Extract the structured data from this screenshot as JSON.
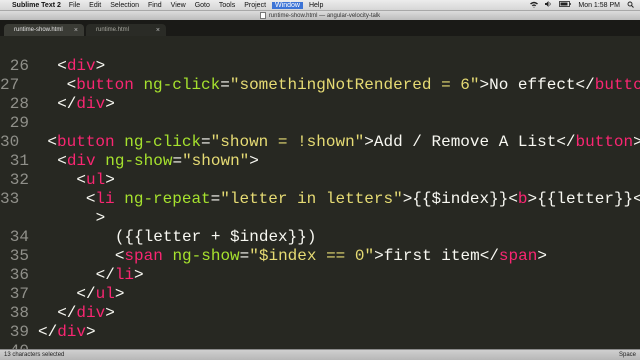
{
  "menubar": {
    "app_name": "Sublime Text 2",
    "items": [
      "File",
      "Edit",
      "Selection",
      "Find",
      "View",
      "Goto",
      "Tools",
      "Project",
      "Window",
      "Help"
    ],
    "active_item": "Window",
    "clock": "Mon 1:58 PM"
  },
  "window": {
    "title": "runtime-show.html — angular-velocity-talk"
  },
  "tabs": [
    {
      "label": "runtime-show.html",
      "active": true
    },
    {
      "label": "runtime.html",
      "active": false
    }
  ],
  "code_lines": [
    {
      "num": "",
      "tokens": []
    },
    {
      "num": "26",
      "tokens": [
        {
          "t": "  ",
          "c": "txt"
        },
        {
          "t": "<",
          "c": "txt"
        },
        {
          "t": "div",
          "c": "tag"
        },
        {
          "t": ">",
          "c": "txt"
        }
      ]
    },
    {
      "num": "27",
      "tokens": [
        {
          "t": "    ",
          "c": "txt"
        },
        {
          "t": "<",
          "c": "txt"
        },
        {
          "t": "button",
          "c": "tag"
        },
        {
          "t": " ",
          "c": "txt"
        },
        {
          "t": "ng-click",
          "c": "attr"
        },
        {
          "t": "=",
          "c": "txt"
        },
        {
          "t": "\"somethingNotRendered = 6\"",
          "c": "str"
        },
        {
          "t": ">No effect</",
          "c": "txt"
        },
        {
          "t": "button",
          "c": "tag"
        },
        {
          "t": ">",
          "c": "txt"
        }
      ]
    },
    {
      "num": "28",
      "tokens": [
        {
          "t": "  ",
          "c": "txt"
        },
        {
          "t": "</",
          "c": "txt"
        },
        {
          "t": "div",
          "c": "tag"
        },
        {
          "t": ">",
          "c": "txt"
        }
      ]
    },
    {
      "num": "29",
      "tokens": []
    },
    {
      "num": "30",
      "tokens": [
        {
          "t": "  ",
          "c": "txt"
        },
        {
          "t": "<",
          "c": "txt"
        },
        {
          "t": "button",
          "c": "tag"
        },
        {
          "t": " ",
          "c": "txt"
        },
        {
          "t": "ng-click",
          "c": "attr"
        },
        {
          "t": "=",
          "c": "txt"
        },
        {
          "t": "\"shown = !shown\"",
          "c": "str"
        },
        {
          "t": ">Add / Remove A List</",
          "c": "txt"
        },
        {
          "t": "button",
          "c": "tag"
        },
        {
          "t": ">",
          "c": "txt"
        }
      ]
    },
    {
      "num": "31",
      "tokens": [
        {
          "t": "  ",
          "c": "txt"
        },
        {
          "t": "<",
          "c": "txt"
        },
        {
          "t": "div",
          "c": "tag"
        },
        {
          "t": " ",
          "c": "txt"
        },
        {
          "t": "ng-show",
          "c": "attr"
        },
        {
          "t": "=",
          "c": "txt"
        },
        {
          "t": "\"shown\"",
          "c": "str"
        },
        {
          "t": ">",
          "c": "txt"
        }
      ]
    },
    {
      "num": "32",
      "tokens": [
        {
          "t": "    ",
          "c": "txt"
        },
        {
          "t": "<",
          "c": "txt"
        },
        {
          "t": "ul",
          "c": "tag"
        },
        {
          "t": ">",
          "c": "txt"
        }
      ]
    },
    {
      "num": "33",
      "tokens": [
        {
          "t": "      ",
          "c": "txt"
        },
        {
          "t": "<",
          "c": "txt"
        },
        {
          "t": "li",
          "c": "tag"
        },
        {
          "t": " ",
          "c": "txt"
        },
        {
          "t": "ng-repeat",
          "c": "attr"
        },
        {
          "t": "=",
          "c": "txt"
        },
        {
          "t": "\"letter in letters\"",
          "c": "str"
        },
        {
          "t": ">{{$index}}<",
          "c": "txt"
        },
        {
          "t": "b",
          "c": "tag"
        },
        {
          "t": ">{{letter}}</",
          "c": "txt"
        },
        {
          "t": "b",
          "c": "tag"
        },
        {
          "t": "><",
          "c": "txt"
        }
      ]
    },
    {
      "num": "",
      "tokens": [
        {
          "t": "      >",
          "c": "txt"
        }
      ]
    },
    {
      "num": "34",
      "tokens": [
        {
          "t": "        ({{letter + $index}})",
          "c": "txt"
        }
      ]
    },
    {
      "num": "35",
      "tokens": [
        {
          "t": "        ",
          "c": "txt"
        },
        {
          "t": "<",
          "c": "txt"
        },
        {
          "t": "span",
          "c": "tag"
        },
        {
          "t": " ",
          "c": "txt"
        },
        {
          "t": "ng-show",
          "c": "attr"
        },
        {
          "t": "=",
          "c": "txt"
        },
        {
          "t": "\"$index == 0\"",
          "c": "str"
        },
        {
          "t": ">first item</",
          "c": "txt"
        },
        {
          "t": "span",
          "c": "tag"
        },
        {
          "t": ">",
          "c": "txt"
        }
      ]
    },
    {
      "num": "36",
      "tokens": [
        {
          "t": "      ",
          "c": "txt"
        },
        {
          "t": "</",
          "c": "txt"
        },
        {
          "t": "li",
          "c": "tag"
        },
        {
          "t": ">",
          "c": "txt"
        }
      ]
    },
    {
      "num": "37",
      "tokens": [
        {
          "t": "    ",
          "c": "txt"
        },
        {
          "t": "</",
          "c": "txt"
        },
        {
          "t": "ul",
          "c": "tag"
        },
        {
          "t": ">",
          "c": "txt"
        }
      ]
    },
    {
      "num": "38",
      "tokens": [
        {
          "t": "  ",
          "c": "txt"
        },
        {
          "t": "</",
          "c": "txt"
        },
        {
          "t": "div",
          "c": "tag"
        },
        {
          "t": ">",
          "c": "txt"
        }
      ]
    },
    {
      "num": "39",
      "tokens": [
        {
          "t": "</",
          "c": "txt"
        },
        {
          "t": "div",
          "c": "tag"
        },
        {
          "t": ">",
          "c": "txt"
        }
      ]
    },
    {
      "num": "40",
      "tokens": []
    }
  ],
  "status": {
    "left": "13 characters selected",
    "right": "Space"
  },
  "colors": {
    "background": "#272822",
    "tag": "#f92672",
    "attribute": "#a6e22e",
    "string": "#e6db74",
    "text": "#f8f8f2",
    "line_number": "#90908a"
  },
  "icons": [
    "apple-icon",
    "wifi-icon",
    "volume-icon",
    "battery-icon",
    "spotlight-icon"
  ]
}
